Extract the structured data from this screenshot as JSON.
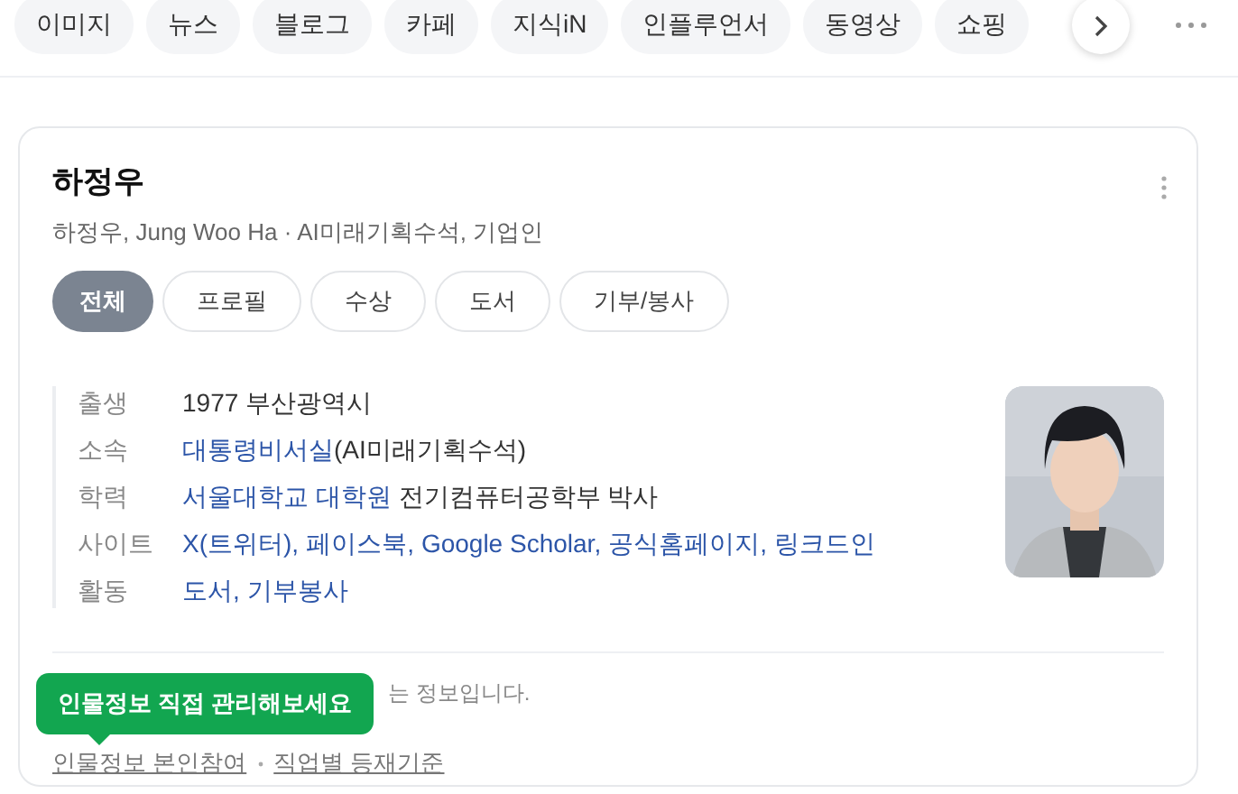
{
  "search_tabs": [
    {
      "label": "이미지",
      "selected": false
    },
    {
      "label": "뉴스",
      "selected": false
    },
    {
      "label": "블로그",
      "selected": false
    },
    {
      "label": "카페",
      "selected": false
    },
    {
      "label": "지식iN",
      "selected": false
    },
    {
      "label": "인플루언서",
      "selected": false
    },
    {
      "label": "동영상",
      "selected": false
    },
    {
      "label": "쇼핑",
      "selected": false
    }
  ],
  "person": {
    "name": "하정우",
    "subtitle": "하정우, Jung Woo Ha · AI미래기획수석, 기업인",
    "tabs": [
      {
        "label": "전체",
        "selected": true
      },
      {
        "label": "프로필",
        "selected": false
      },
      {
        "label": "수상",
        "selected": false
      },
      {
        "label": "도서",
        "selected": false
      },
      {
        "label": "기부/봉사",
        "selected": false
      }
    ],
    "info": [
      {
        "label": "출생",
        "segments": [
          {
            "kind": "text",
            "text": "1977 부산광역시"
          }
        ]
      },
      {
        "label": "소속",
        "segments": [
          {
            "kind": "link",
            "text": "대통령비서실"
          },
          {
            "kind": "text",
            "text": "(AI미래기획수석)"
          }
        ]
      },
      {
        "label": "학력",
        "segments": [
          {
            "kind": "link",
            "text": "서울대학교 대학원"
          },
          {
            "kind": "text",
            "text": " 전기컴퓨터공학부 박사"
          }
        ]
      },
      {
        "label": "사이트",
        "segments": [
          {
            "kind": "link",
            "text": "X(트위터)",
            "suffix": ","
          },
          {
            "kind": "link",
            "text": "페이스북",
            "suffix": ","
          },
          {
            "kind": "link",
            "text": "Google Scholar",
            "suffix": ","
          },
          {
            "kind": "link",
            "text": "공식홈페이지",
            "suffix": ","
          },
          {
            "kind": "link",
            "text": "링크드인"
          }
        ]
      },
      {
        "label": "활동",
        "segments": [
          {
            "kind": "link",
            "text": "도서",
            "suffix": ","
          },
          {
            "kind": "link",
            "text": "기부봉사"
          }
        ]
      }
    ],
    "notice": "는 정보입니다.",
    "tooltip": "인물정보 직접 관리해보세요",
    "footer_links": [
      "인물정보 본인참여",
      "직업별 등재기준"
    ]
  }
}
